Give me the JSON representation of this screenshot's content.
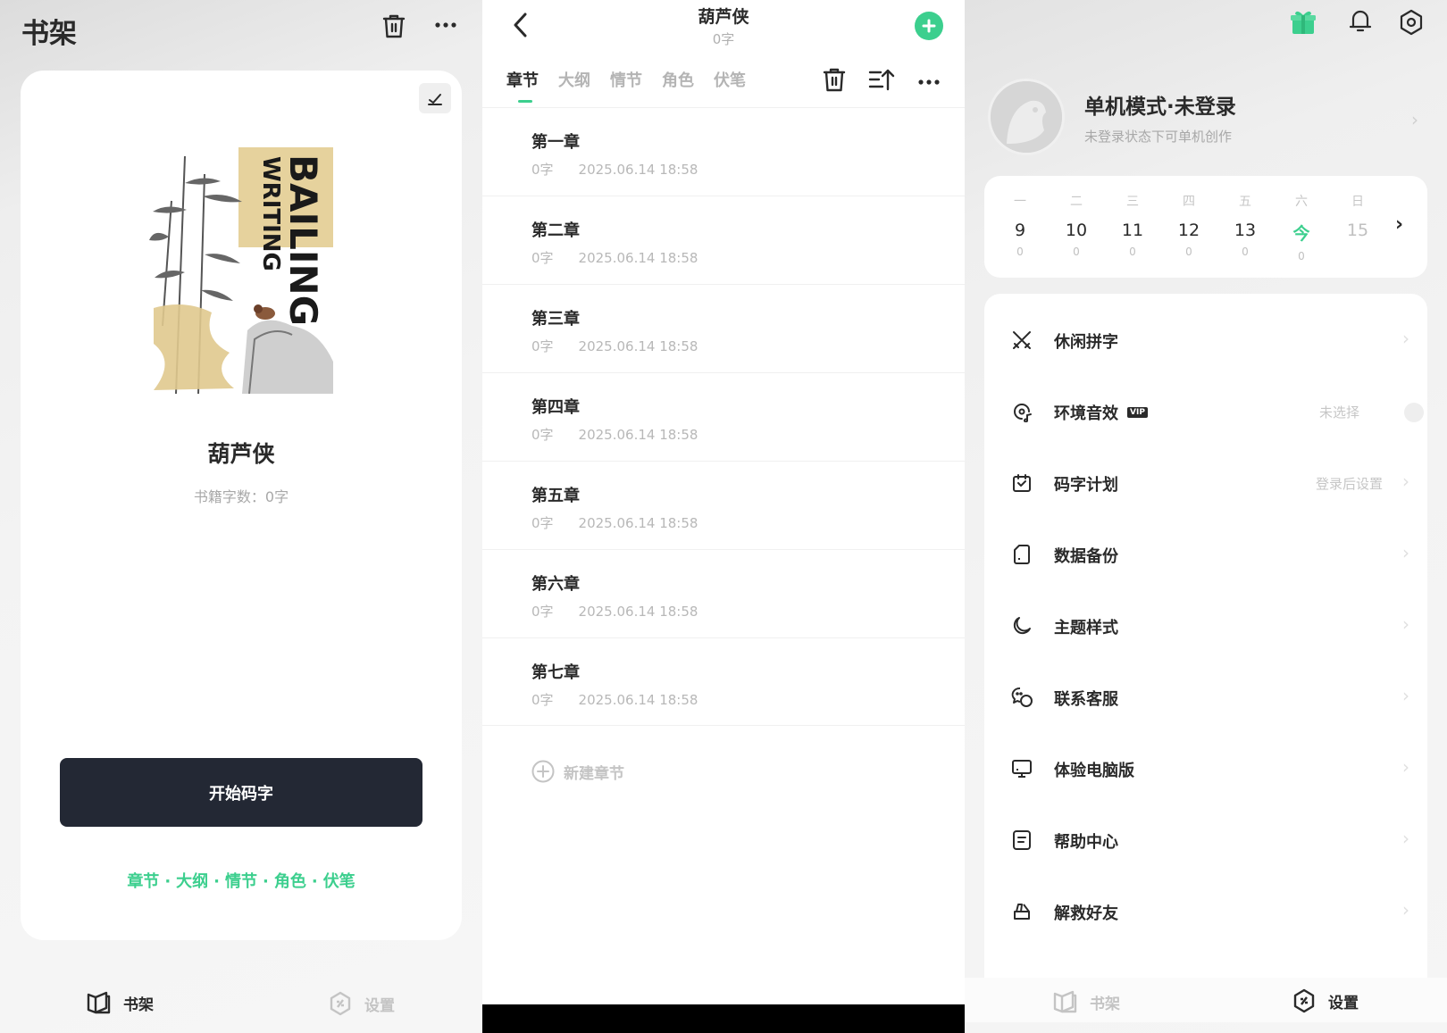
{
  "shelf": {
    "title": "书架",
    "book": {
      "title": "葫芦侠",
      "word_count": "书籍字数：0字",
      "cover_text_1": "BAILING",
      "cover_text_2": "WRITING"
    },
    "start_button": "开始码字",
    "quick_links": [
      "章节",
      "大纲",
      "情节",
      "角色",
      "伏笔"
    ],
    "quick_links_separator": "·",
    "tabbar": {
      "shelf": "书架",
      "settings": "设置"
    }
  },
  "chapters": {
    "title": "葫芦侠",
    "subtitle": "0字",
    "tabs": [
      "章节",
      "大纲",
      "情节",
      "角色",
      "伏笔"
    ],
    "active_tab": "章节",
    "items": [
      {
        "name": "第一章",
        "count": "0字",
        "date": "2025.06.14 18:58"
      },
      {
        "name": "第二章",
        "count": "0字",
        "date": "2025.06.14 18:58"
      },
      {
        "name": "第三章",
        "count": "0字",
        "date": "2025.06.14 18:58"
      },
      {
        "name": "第四章",
        "count": "0字",
        "date": "2025.06.14 18:58"
      },
      {
        "name": "第五章",
        "count": "0字",
        "date": "2025.06.14 18:58"
      },
      {
        "name": "第六章",
        "count": "0字",
        "date": "2025.06.14 18:58"
      },
      {
        "name": "第七章",
        "count": "0字",
        "date": "2025.06.14 18:58"
      }
    ],
    "new_chapter": "新建章节"
  },
  "settings": {
    "user": {
      "name": "单机模式·未登录",
      "subtitle": "未登录状态下可单机创作"
    },
    "week": [
      {
        "dn": "一",
        "dd": "9",
        "dc": "0"
      },
      {
        "dn": "二",
        "dd": "10",
        "dc": "0"
      },
      {
        "dn": "三",
        "dd": "11",
        "dc": "0"
      },
      {
        "dn": "四",
        "dd": "12",
        "dc": "0"
      },
      {
        "dn": "五",
        "dd": "13",
        "dc": "0"
      },
      {
        "dn": "六",
        "dd": "今",
        "dc": "0"
      },
      {
        "dn": "日",
        "dd": "15",
        "dc": ""
      }
    ],
    "menu": [
      {
        "label": "休闲拼字",
        "icon": "swords-icon",
        "right": ""
      },
      {
        "label": "环境音效",
        "icon": "music-disc-icon",
        "right": "未选择",
        "badge": "VIP"
      },
      {
        "label": "码字计划",
        "icon": "calendar-icon",
        "right": "登录后设置"
      },
      {
        "label": "数据备份",
        "icon": "file-icon",
        "right": ""
      },
      {
        "label": "主题样式",
        "icon": "moon-icon",
        "right": ""
      },
      {
        "label": "联系客服",
        "icon": "chat-icon",
        "right": ""
      },
      {
        "label": "体验电脑版",
        "icon": "monitor-icon",
        "right": ""
      },
      {
        "label": "帮助中心",
        "icon": "document-icon",
        "right": ""
      },
      {
        "label": "解救好友",
        "icon": "rescue-icon",
        "right": ""
      }
    ],
    "tabbar": {
      "shelf": "书架",
      "settings": "设置"
    }
  },
  "colors": {
    "accent": "#3ccf8e",
    "dark_button": "#232834",
    "muted": "#b8b8b8"
  }
}
